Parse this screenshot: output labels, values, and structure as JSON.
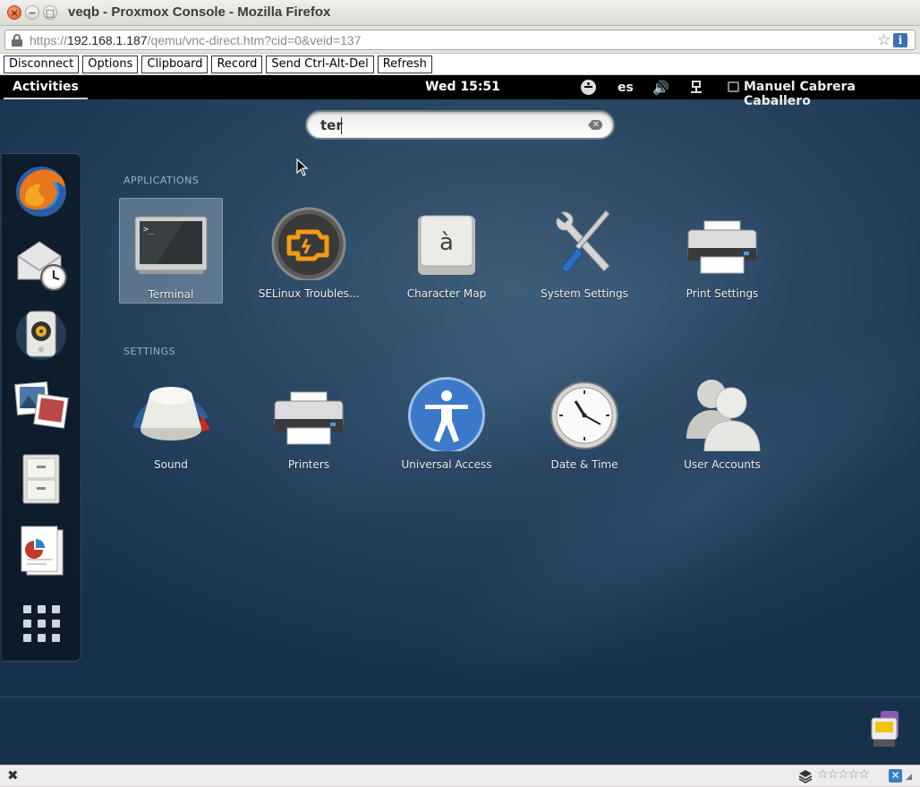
{
  "window": {
    "title": "veqb - Proxmox Console - Mozilla Firefox",
    "close_glyph": "×",
    "min_glyph": "−",
    "max_glyph": "□"
  },
  "urlbar": {
    "prefix": "https://",
    "host": "192.168.1.187",
    "path": "/qemu/vnc-direct.htm?cid=0&veid=137",
    "star_glyph": "☆",
    "info_glyph": "i"
  },
  "vnc_toolbar": {
    "buttons": [
      "Disconnect",
      "Options",
      "Clipboard",
      "Record",
      "Send Ctrl-Alt-Del",
      "Refresh"
    ]
  },
  "topbar": {
    "activities": "Activities",
    "clock": "Wed 15:51",
    "language": "es",
    "volume_glyph": "🔊",
    "user": "Manuel Cabrera Caballero"
  },
  "search": {
    "query": "ter",
    "clear_glyph": "✕"
  },
  "dash": {
    "items": [
      "firefox-icon",
      "mail-icon",
      "sound-app-icon",
      "photos-icon",
      "files-icon",
      "office-icon",
      "app-grid-icon"
    ]
  },
  "applications": {
    "header": "APPLICATIONS",
    "items": [
      {
        "label": "Terminal",
        "icon": "terminal-icon",
        "selected": true
      },
      {
        "label": "SELinux Troubles...",
        "icon": "selinux-icon"
      },
      {
        "label": "Character Map",
        "icon": "character-map-icon",
        "glyph": "à"
      },
      {
        "label": "System Settings",
        "icon": "system-settings-icon"
      },
      {
        "label": "Print Settings",
        "icon": "printer-icon"
      }
    ]
  },
  "settings": {
    "header": "SETTINGS",
    "items": [
      {
        "label": "Sound",
        "icon": "sound-icon"
      },
      {
        "label": "Printers",
        "icon": "printers-icon"
      },
      {
        "label": "Universal Access",
        "icon": "universal-access-icon"
      },
      {
        "label": "Date & Time",
        "icon": "clock-icon"
      },
      {
        "label": "User Accounts",
        "icon": "users-icon"
      }
    ]
  },
  "statusbar": {
    "close_glyph": "✖",
    "stars": "☆☆☆☆☆",
    "addon_glyph": "✕",
    "grip_glyph": "◢"
  },
  "colors": {
    "desktop_bg": "#294663",
    "topbar_bg": "#000000",
    "selected_tile": "#8fa2b6"
  }
}
